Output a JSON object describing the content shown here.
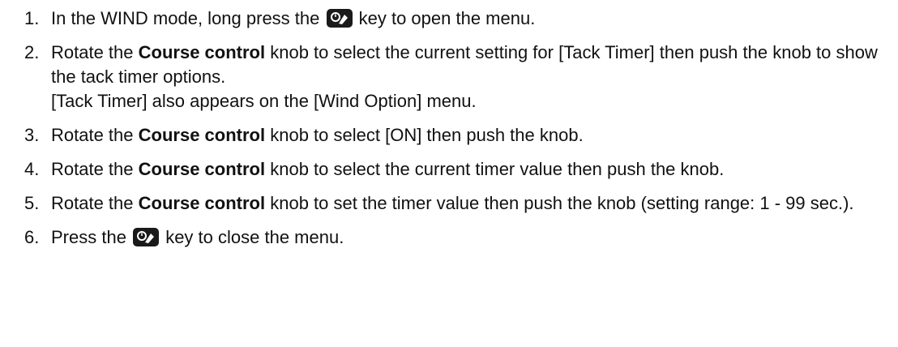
{
  "steps": [
    {
      "num": "1.",
      "before": "In the WIND mode, long press the",
      "icon": "menu-key-icon",
      "after": "key to open the menu."
    },
    {
      "num": "2.",
      "before": "Rotate the",
      "bold": "Course control",
      "after": "knob to select the current setting for [Tack Timer] then push the knob to show the tack timer options.",
      "note": "[Tack Timer] also appears on the [Wind Option] menu."
    },
    {
      "num": "3.",
      "before": "Rotate the",
      "bold": "Course control",
      "after": "knob to select [ON] then push the knob."
    },
    {
      "num": "4.",
      "before": "Rotate the",
      "bold": "Course control",
      "after": "knob to select the current timer value then push the knob."
    },
    {
      "num": "5.",
      "before": "Rotate the",
      "bold": "Course control",
      "after": "knob to set the timer value then push the knob (setting range: 1 - 99 sec.)."
    },
    {
      "num": "6.",
      "before": "Press the",
      "icon": "menu-key-icon",
      "after": "key to close the menu."
    }
  ]
}
